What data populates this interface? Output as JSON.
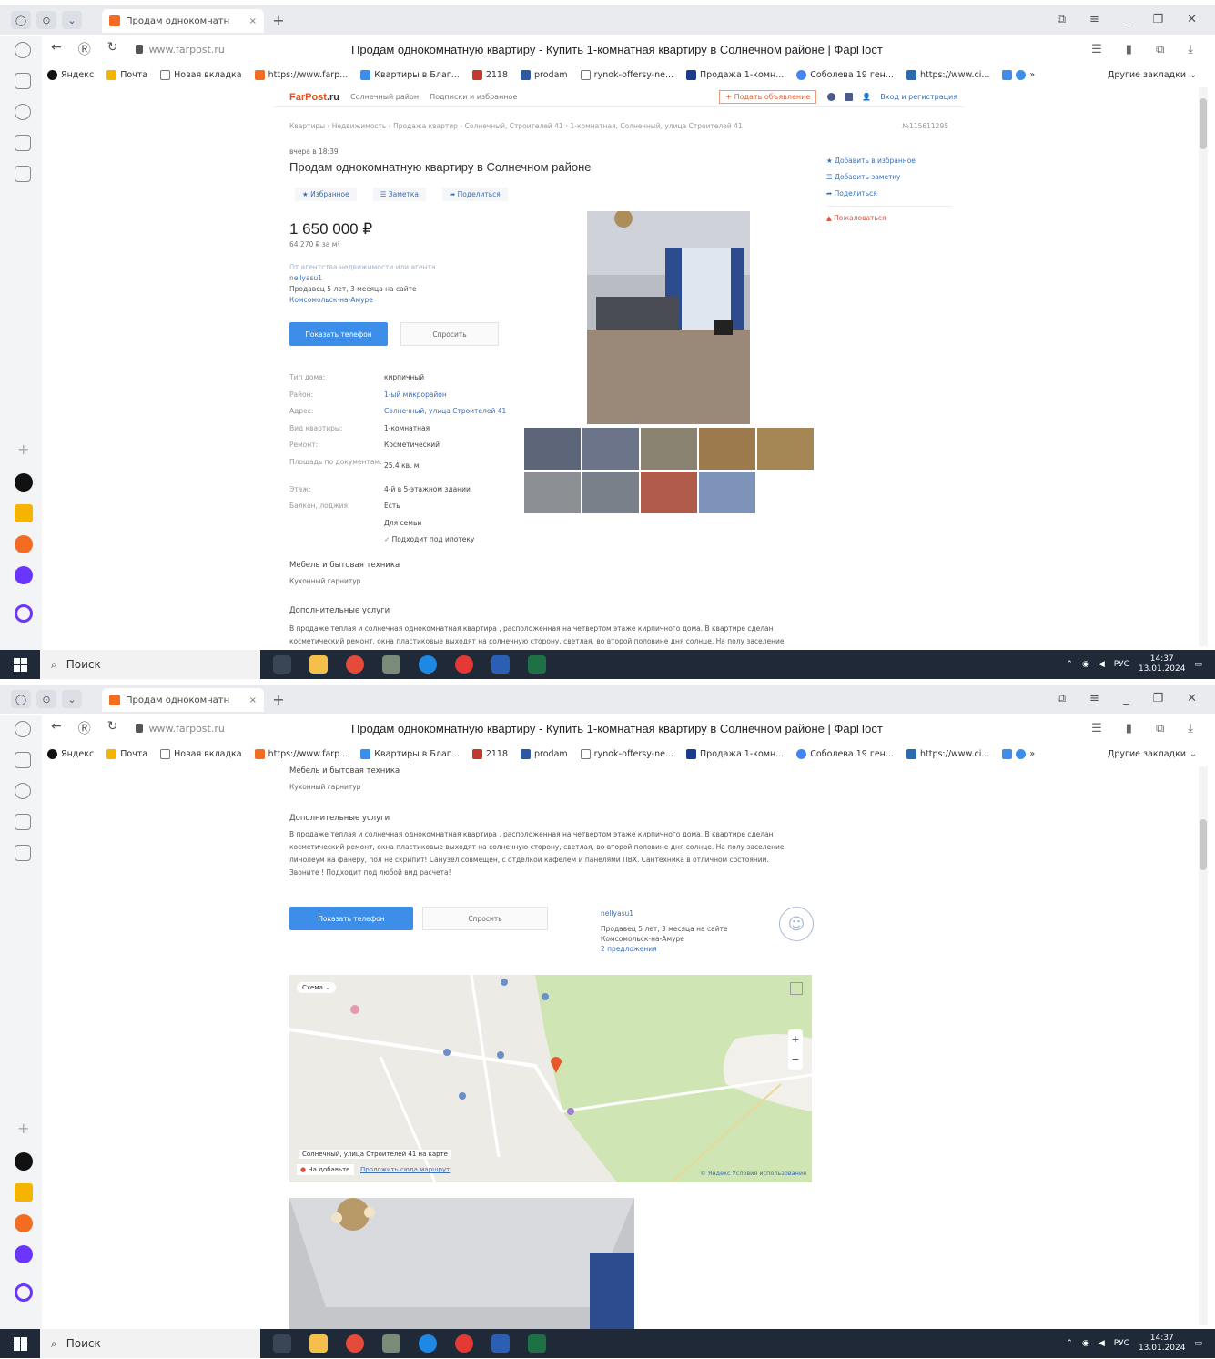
{
  "browser": {
    "tab_title": "Продам однокомнатн",
    "tab_close": "×",
    "new_tab": "+",
    "domain": "www.farpost.ru",
    "page_title": "Продам однокомнатную квартиру - Купить 1-комнатная квартиру в Солнечном районе | ФарПост",
    "bookmarks": [
      "Яндекс",
      "Почта",
      "Новая вкладка",
      "https://www.farp...",
      "Квартиры в Благ...",
      "2118",
      "prodam",
      "rynok-offersy-ne...",
      "Продажа 1-комн...",
      "Соболева 19 ген...",
      "https://www.ci...",
      "»"
    ],
    "bookmarks_more": "Другие закладки"
  },
  "taskbar": {
    "search_label": "Поиск",
    "lang": "РУС",
    "time": "14:37",
    "date": "13.01.2024"
  },
  "site": {
    "logo_main": "FarPost",
    "logo_tld": ".ru",
    "region": "Солнечный район",
    "submenu": "Подписки и избранное",
    "submit_ad": "+ Подать объявление",
    "login": "Вход и регистрация"
  },
  "listing": {
    "breadcrumb": "Квартиры › Недвижимость › Продажа квартир › Солнечный, Строителей 41 › 1-комнатная, Солнечный, улица Строителей 41",
    "ad_id": "№115611295",
    "posted": "вчера в 18:39",
    "title": "Продам однокомнатную квартиру в Солнечном районе",
    "actions": [
      "★ Избранное",
      "☰ Заметка",
      "➦ Поделиться"
    ],
    "side_actions": [
      "★ Добавить в избранное",
      "☰ Добавить заметку",
      "➦ Поделиться"
    ],
    "complain": "▲ Пожаловаться",
    "price": "1 650 000 ₽",
    "price_per_m2": "64 270 ₽ за м²",
    "agency_note": "От агентства недвижимости или агента",
    "seller_name": "nellyasu1",
    "seller_since": "Продавец 5 лет, 3 месяца на сайте",
    "seller_city": "Комсомольск-на-Амуре",
    "btn_phone": "Показать телефон",
    "btn_ask": "Спросить",
    "params": [
      {
        "k": "Тип дома:",
        "v": "кирпичный",
        "link": false
      },
      {
        "k": "Район:",
        "v": "1-ый микрорайон",
        "link": true
      },
      {
        "k": "Адрес:",
        "v": "Солнечный, улица Строителей 41",
        "link": true
      },
      {
        "k": "Вид квартиры:",
        "v": "1-комнатная",
        "link": false
      },
      {
        "k": "Ремонт:",
        "v": "Косметический",
        "link": false
      }
    ],
    "area_label": "Площадь по документам:",
    "area_value": "25.4 кв. м.",
    "floor_label": "Этаж:",
    "floor_value": "4-й в 5-этажном здании",
    "balcony_label": "Балкон, лоджия:",
    "balcony_value": "Есть",
    "extra_value": "Для семьи",
    "mortgage": "Подходит под ипотеку",
    "furniture_title": "Мебель и бытовая техника",
    "furniture_value": "Кухонный гарнитур",
    "extra_title": "Дополнительные услуги",
    "description_1": "В продаже теплая и солнечная однокомнатная квартира , расположенная на четвертом этаже кирпичного дома. В квартире сделан",
    "description_2": "косметический ремонт, окна пластиковые выходят на солнечную сторону, светлая, во второй половине дня солнце. На полу заселение",
    "description_3": "линолеум на фанеру, пол не скрипит! Санузел совмещен, с отделкой кафелем и панелями ПВХ. Сантехника в отличном состоянии.",
    "description_4": "Звоните ! Подходит под любой вид расчета!",
    "seller_offers": "2 предложения"
  },
  "map": {
    "layers": "Схема",
    "caption": "Солнечный, улица Строителей 41 на карте",
    "favorites": "На добавьте",
    "route": "Проложить сюда маршрут",
    "provider": "© Яндекс Условия использования"
  }
}
